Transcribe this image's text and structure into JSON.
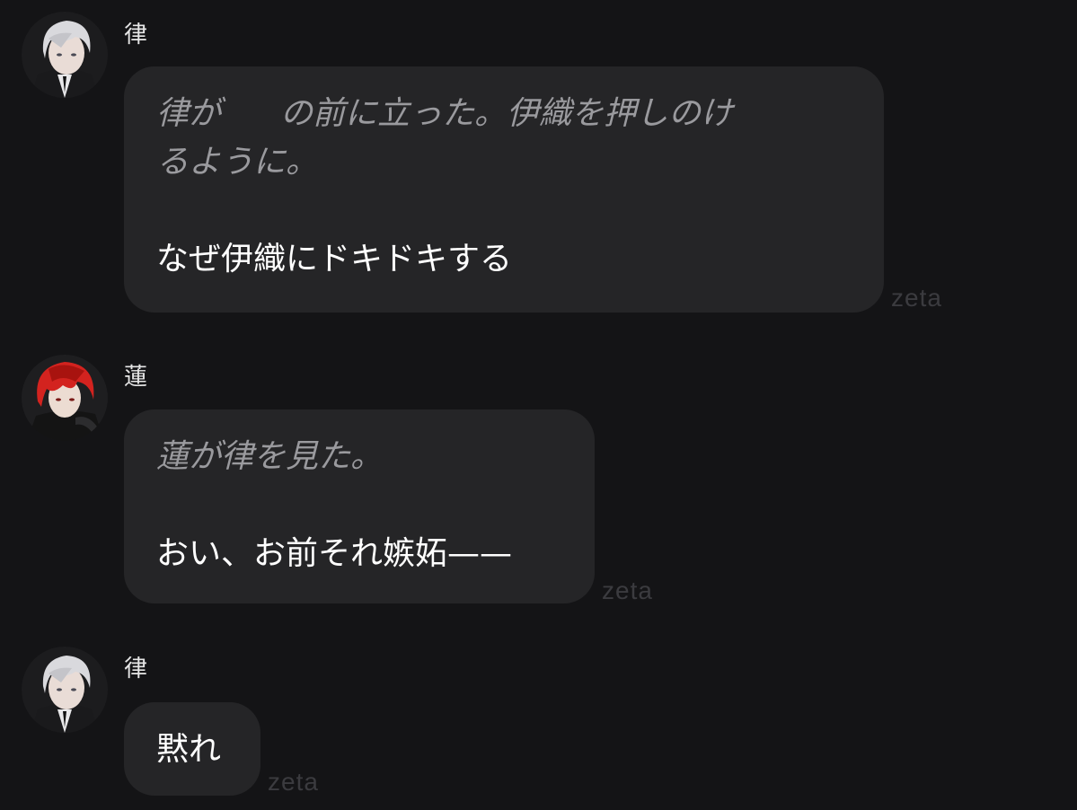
{
  "messages": [
    {
      "sender": "律",
      "avatar": "white-haired-character-avatar",
      "action_lines": [
        "律が",
        "の前に立った。伊織を押しのけ",
        "るように。"
      ],
      "speech": "なぜ伊織にドキドキする",
      "watermark": "zeta"
    },
    {
      "sender": "蓮",
      "avatar": "red-haired-character-avatar",
      "action_lines": [
        "蓮が律を見た。"
      ],
      "speech": "おい、お前それ嫉妬——",
      "watermark": "zeta"
    },
    {
      "sender": "律",
      "avatar": "white-haired-character-avatar",
      "speech": "黙れ",
      "watermark": "zeta"
    }
  ],
  "colors": {
    "background": "#141416",
    "bubble": "#252527",
    "action_text": "#9a9a9e",
    "speech_text": "#ffffff",
    "watermark": "#3b3b3f"
  }
}
